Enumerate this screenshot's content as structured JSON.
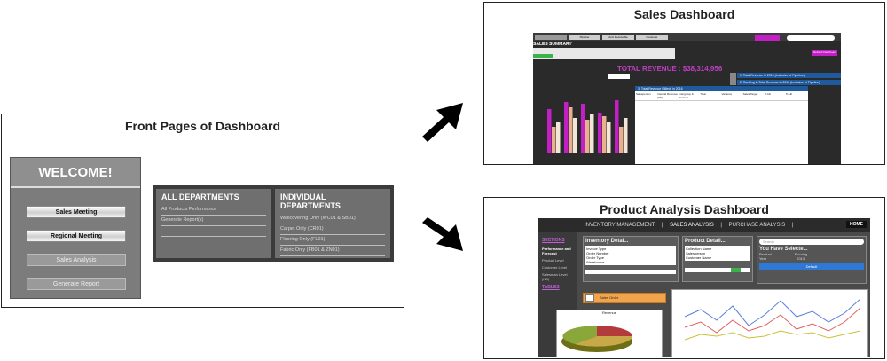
{
  "front": {
    "title": "Front Pages of Dashboard",
    "welcome": {
      "heading": "WELCOME!",
      "buttons": [
        "Sales Meeting",
        "Regional Meeting",
        "Sales Analysis",
        "Generate Report"
      ]
    },
    "all_departments": {
      "heading": "ALL DEPARTMENTS",
      "items": [
        "All Products Performance",
        "Generate Report(s)"
      ]
    },
    "individual_departments": {
      "heading": "INDIVIDUAL DEPARTMENTS",
      "items": [
        "Wallcovering Only (WC01 & SB01)",
        "Carpet Only (CR01)",
        "Flooring Only (FL01)",
        "Fabric Only (FB01 & ZN01)"
      ]
    }
  },
  "sales": {
    "title": "Sales Dashboard",
    "tabs": [
      "Pipeline",
      "Acct Receivable",
      "Customer"
    ],
    "summary": "SALES SUMMARY",
    "total_revenue": "TOTAL REVENUE : $38,314,956",
    "blue_bars": [
      "1. Total Revenue in 2016 (Inclusive of Pipeline)",
      "2. Ranking in Total Revenue in 2016 (Inclusive of Pipeline)"
    ],
    "table_header": "3. Total Revenue (Billed) in 2016",
    "table_cols": [
      "Salesperson",
      "Internal Revenue (S$)",
      "Intergroup & Related",
      "Total",
      "Variance",
      "Sales Target",
      "% Hit",
      "% Hit"
    ],
    "button": "Refresh Dashboard",
    "bar_colors": [
      "#c21fc6",
      "#e6b18c",
      "#f2e6d9"
    ]
  },
  "product": {
    "title": "Product Analysis Dashboard",
    "nav": [
      "INVENTORY MANAGEMENT",
      "SALES ANALYSIS",
      "PURCHASE ANALYSIS"
    ],
    "home": "HOME",
    "sections_label": "SECTIONS",
    "sections": [
      "Performance and Forecast",
      "Product Level",
      "Customer Level",
      "Salesman Level (NS)"
    ],
    "tables_label": "TABLES",
    "inventory_title": "Inventory Detai...",
    "inventory_fields": [
      "Invoice Type",
      "Order Number",
      "Order Type",
      "Warehouse"
    ],
    "product_title": "Product Detail...",
    "product_fields": [
      "Collection Name",
      "Salesperson",
      "Customer Name"
    ],
    "search_placeholder": "Search",
    "selected_title": "You Have Selecte...",
    "selected_fields": [
      [
        "Product",
        "Flooring"
      ],
      [
        "Year",
        "2013"
      ]
    ],
    "default_button": "Default",
    "sales_order": "Sales Order",
    "pie_title": "Revenue",
    "line_colors": [
      "#5a7fd6",
      "#e06060",
      "#c8c23a"
    ]
  }
}
